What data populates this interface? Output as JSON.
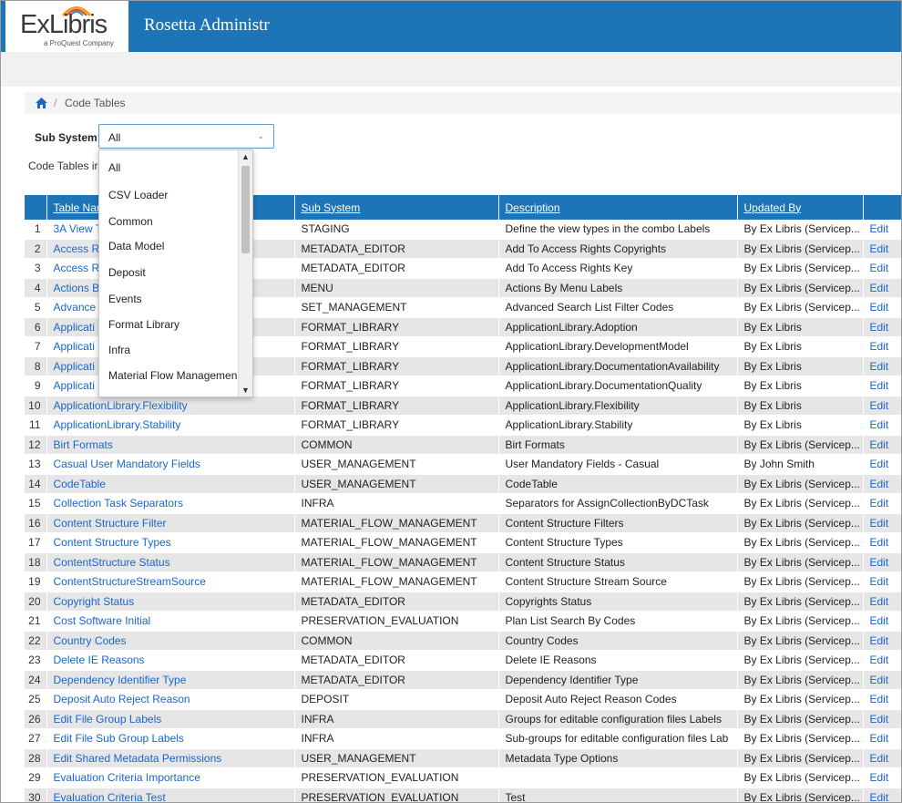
{
  "header": {
    "logo_text": "ExLibris",
    "logo_sub": "a ProQuest Company",
    "app_title": "Rosetta Administr",
    "brand_color": "#1d75b8"
  },
  "breadcrumb": {
    "home_icon": "home-icon",
    "separator": "/",
    "current": "Code Tables"
  },
  "filter": {
    "label": "Sub System:",
    "selected": "All",
    "caret": "⌄",
    "options": [
      "All",
      "CSV Loader",
      "Common",
      "Data Model",
      "Deposit",
      "Events",
      "Format Library",
      "Infra",
      "Material Flow Managemen"
    ]
  },
  "intro_text": "Code Tables ir",
  "table": {
    "columns": [
      "Table Nar",
      "Sub System",
      "Description",
      "Updated By",
      ""
    ],
    "rows": [
      {
        "n": "1",
        "name": "3A View T",
        "sub": "STAGING",
        "desc": "Define the view types in the combo Labels",
        "by": "By Ex Libris (Servicep...",
        "edit": "Edit"
      },
      {
        "n": "2",
        "name": "Access R",
        "sub": "METADATA_EDITOR",
        "desc": "Add To Access Rights Copyrights",
        "by": "By Ex Libris (Servicep...",
        "edit": "Edit"
      },
      {
        "n": "3",
        "name": "Access R",
        "sub": "METADATA_EDITOR",
        "desc": "Add To Access Rights Key",
        "by": "By Ex Libris (Servicep...",
        "edit": "Edit"
      },
      {
        "n": "4",
        "name": "Actions B",
        "sub": "MENU",
        "desc": "Actions By Menu Labels",
        "by": "By Ex Libris (Servicep...",
        "edit": "Edit"
      },
      {
        "n": "5",
        "name": "Advance",
        "sub": "SET_MANAGEMENT",
        "desc": "Advanced Search List Filter Codes",
        "by": "By Ex Libris (Servicep...",
        "edit": "Edit"
      },
      {
        "n": "6",
        "name": "Applicati",
        "sub": "FORMAT_LIBRARY",
        "desc": "ApplicationLibrary.Adoption",
        "by": "By Ex Libris",
        "edit": "Edit"
      },
      {
        "n": "7",
        "name": "Applicati",
        "sub": "FORMAT_LIBRARY",
        "desc": "ApplicationLibrary.DevelopmentModel",
        "by": "By Ex Libris",
        "edit": "Edit"
      },
      {
        "n": "8",
        "name": "Applicati                          bility",
        "sub": "FORMAT_LIBRARY",
        "desc": "ApplicationLibrary.DocumentationAvailability",
        "by": "By Ex Libris",
        "edit": "Edit"
      },
      {
        "n": "9",
        "name": "Applicati",
        "sub": "FORMAT_LIBRARY",
        "desc": "ApplicationLibrary.DocumentationQuality",
        "by": "By Ex Libris",
        "edit": "Edit"
      },
      {
        "n": "10",
        "name": "ApplicationLibrary.Flexibility",
        "sub": "FORMAT_LIBRARY",
        "desc": "ApplicationLibrary.Flexibility",
        "by": "By Ex Libris",
        "edit": "Edit"
      },
      {
        "n": "11",
        "name": "ApplicationLibrary.Stability",
        "sub": "FORMAT_LIBRARY",
        "desc": "ApplicationLibrary.Stability",
        "by": "By Ex Libris",
        "edit": "Edit"
      },
      {
        "n": "12",
        "name": "Birt Formats",
        "sub": "COMMON",
        "desc": "Birt Formats",
        "by": "By Ex Libris (Servicep...",
        "edit": "Edit"
      },
      {
        "n": "13",
        "name": "Casual User Mandatory Fields",
        "sub": "USER_MANAGEMENT",
        "desc": "User Mandatory Fields - Casual",
        "by": "By John Smith",
        "edit": "Edit"
      },
      {
        "n": "14",
        "name": "CodeTable",
        "sub": "USER_MANAGEMENT",
        "desc": "CodeTable",
        "by": "By Ex Libris (Servicep...",
        "edit": "Edit"
      },
      {
        "n": "15",
        "name": "Collection Task Separators",
        "sub": "INFRA",
        "desc": "Separators for AssignCollectionByDCTask",
        "by": "By Ex Libris (Servicep...",
        "edit": "Edit"
      },
      {
        "n": "16",
        "name": "Content Structure Filter",
        "sub": "MATERIAL_FLOW_MANAGEMENT",
        "desc": "Content Structure Filters",
        "by": "By Ex Libris (Servicep...",
        "edit": "Edit"
      },
      {
        "n": "17",
        "name": "Content Structure Types",
        "sub": "MATERIAL_FLOW_MANAGEMENT",
        "desc": "Content Structure Types",
        "by": "By Ex Libris (Servicep...",
        "edit": "Edit"
      },
      {
        "n": "18",
        "name": "ContentStructure Status",
        "sub": "MATERIAL_FLOW_MANAGEMENT",
        "desc": "Content Structure Status",
        "by": "By Ex Libris (Servicep...",
        "edit": "Edit"
      },
      {
        "n": "19",
        "name": "ContentStructureStreamSource",
        "sub": "MATERIAL_FLOW_MANAGEMENT",
        "desc": "Content Structure Stream Source",
        "by": "By Ex Libris (Servicep...",
        "edit": "Edit"
      },
      {
        "n": "20",
        "name": "Copyright Status",
        "sub": "METADATA_EDITOR",
        "desc": "Copyrights Status",
        "by": "By Ex Libris (Servicep...",
        "edit": "Edit"
      },
      {
        "n": "21",
        "name": "Cost Software Initial",
        "sub": "PRESERVATION_EVALUATION",
        "desc": "Plan List Search By Codes",
        "by": "By Ex Libris (Servicep...",
        "edit": "Edit"
      },
      {
        "n": "22",
        "name": "Country Codes",
        "sub": "COMMON",
        "desc": "Country Codes",
        "by": "By Ex Libris (Servicep...",
        "edit": "Edit"
      },
      {
        "n": "23",
        "name": "Delete IE Reasons",
        "sub": "METADATA_EDITOR",
        "desc": "Delete IE Reasons",
        "by": "By Ex Libris (Servicep...",
        "edit": "Edit"
      },
      {
        "n": "24",
        "name": "Dependency Identifier Type",
        "sub": "METADATA_EDITOR",
        "desc": "Dependency Identifier Type",
        "by": "By Ex Libris (Servicep...",
        "edit": "Edit"
      },
      {
        "n": "25",
        "name": "Deposit Auto Reject Reason",
        "sub": "DEPOSIT",
        "desc": "Deposit Auto Reject Reason Codes",
        "by": "By Ex Libris (Servicep...",
        "edit": "Edit"
      },
      {
        "n": "26",
        "name": "Edit File Group Labels",
        "sub": "INFRA",
        "desc": "Groups for editable configuration files Labels",
        "by": "By Ex Libris (Servicep...",
        "edit": "Edit"
      },
      {
        "n": "27",
        "name": "Edit File Sub Group Labels",
        "sub": "INFRA",
        "desc": "Sub-groups for editable configuration files Lab",
        "by": "By Ex Libris (Servicep...",
        "edit": "Edit"
      },
      {
        "n": "28",
        "name": "Edit Shared Metadata Permissions",
        "sub": "USER_MANAGEMENT",
        "desc": "Metadata Type Options",
        "by": "By Ex Libris (Servicep...",
        "edit": "Edit"
      },
      {
        "n": "29",
        "name": "Evaluation Criteria Importance",
        "sub": "PRESERVATION_EVALUATION",
        "desc": "",
        "by": "By Ex Libris (Servicep...",
        "edit": "Edit"
      },
      {
        "n": "30",
        "name": "Evaluation Criteria Test",
        "sub": "PRESERVATION_EVALUATION",
        "desc": "Test",
        "by": "By Ex Libris (Servicep...",
        "edit": "Edit"
      }
    ]
  }
}
